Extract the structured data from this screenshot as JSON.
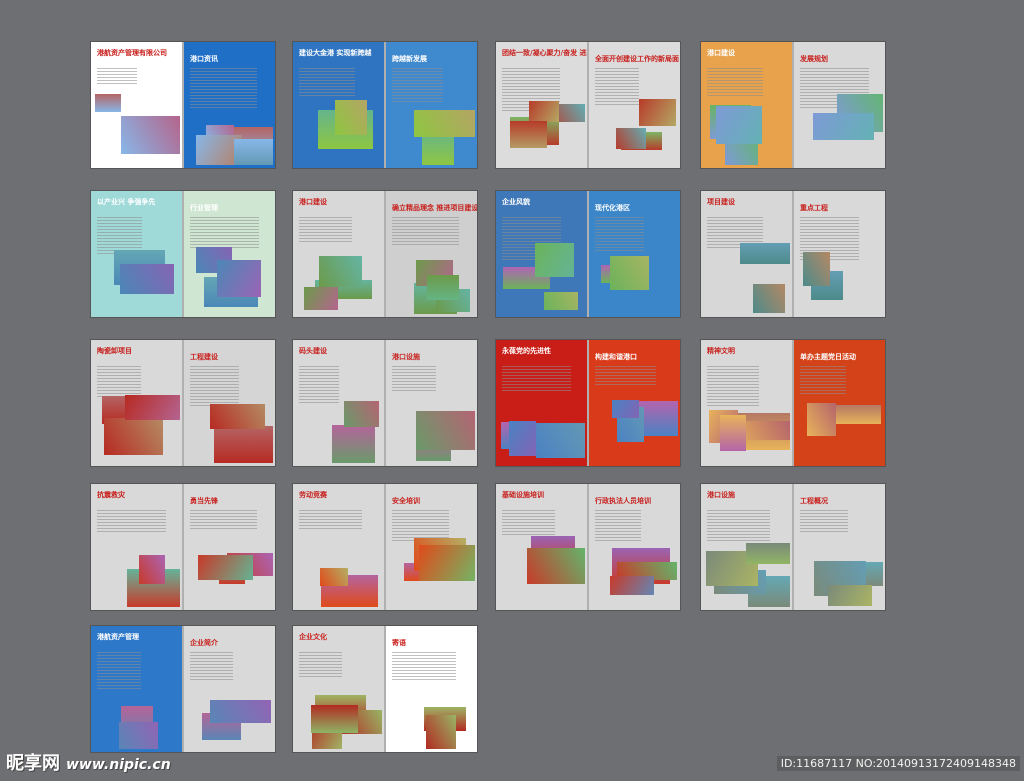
{
  "spreads": [
    {
      "hdr_left": "港航资产管理有限公司",
      "hdr_right": "港口资讯"
    },
    {
      "hdr_left": "建设大金港 实现新跨越",
      "hdr_right": "跨越新发展"
    },
    {
      "hdr_left": "团结一致/凝心聚力/奋发 进取/扎实苦干",
      "hdr_right": "全面开创建设工作的新局面"
    },
    {
      "hdr_left": "港口建设",
      "hdr_right": "发展规划"
    },
    {
      "hdr_left": "以产业兴 争强争先",
      "hdr_right": "行业管理"
    },
    {
      "hdr_left": "港口建设",
      "hdr_right": "确立精品理念 推进项目建设"
    },
    {
      "hdr_left": "企业风貌",
      "hdr_right": "现代化港区"
    },
    {
      "hdr_left": "项目建设",
      "hdr_right": "重点工程"
    },
    {
      "hdr_left": "陶瓷卸项目",
      "hdr_right": "工程建设"
    },
    {
      "hdr_left": "码头建设",
      "hdr_right": "港口设施"
    },
    {
      "hdr_left": "永葆党的先进性",
      "hdr_right": "构建和谐港口"
    },
    {
      "hdr_left": "精神文明",
      "hdr_right": "单办主题党日活动"
    },
    {
      "hdr_left": "抗震救灾",
      "hdr_right": "勇当先锋"
    },
    {
      "hdr_left": "劳动竞赛",
      "hdr_right": "安全培训"
    },
    {
      "hdr_left": "基础设施培训",
      "hdr_right": "行政执法人员培训"
    },
    {
      "hdr_left": "港口设施",
      "hdr_right": "工程概况"
    },
    {
      "hdr_left": "港航资产管理",
      "hdr_right": "企业简介"
    },
    {
      "hdr_left": "企业文化",
      "hdr_right": "寄语"
    }
  ],
  "watermark": {
    "logo": "昵享网",
    "url": "www.nipic.cn"
  },
  "footer_id": "ID:11687117 NO:20140913172409148348"
}
